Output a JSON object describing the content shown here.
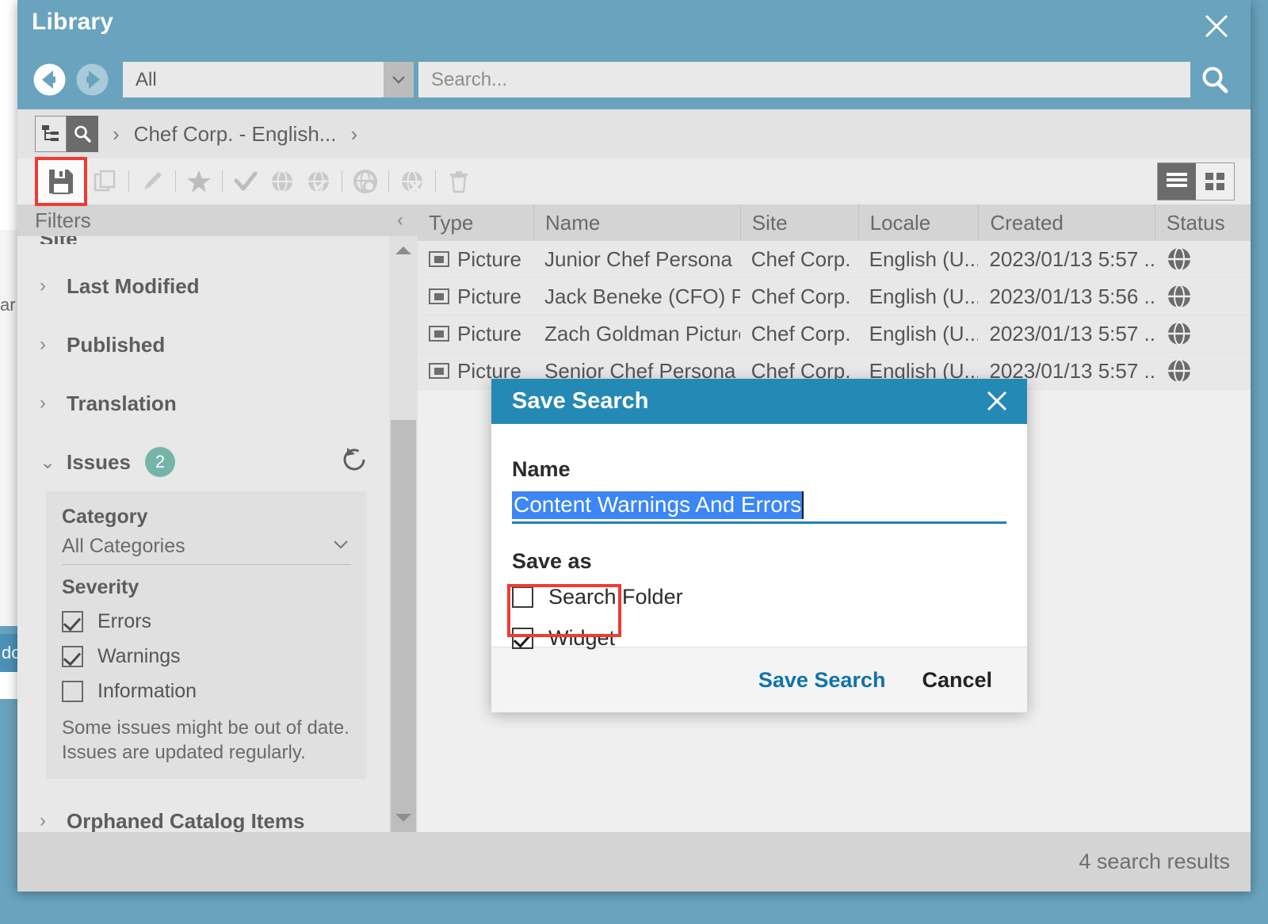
{
  "window": {
    "title": "Library",
    "close_label": "✕"
  },
  "search": {
    "type_value": "All",
    "placeholder": "Search...",
    "back_icon": "arrow-left-circle-icon",
    "forward_icon": "arrow-right-circle-icon",
    "search_icon": "magnifier-icon"
  },
  "breadcrumb": {
    "tree_icon": "tree-view-icon",
    "search_icon": "search-view-icon",
    "separator": "›",
    "path": "Chef Corp. - English...",
    "trailing_separator": "›"
  },
  "toolbar": {
    "items": [
      {
        "name": "save-search",
        "icon": "floppy-disk-icon",
        "disabled": false,
        "highlighted": true
      },
      {
        "name": "copy",
        "icon": "copy-icon",
        "disabled": true
      },
      {
        "name": "edit",
        "icon": "pencil-icon",
        "disabled": true
      },
      {
        "name": "favorite",
        "icon": "star-icon",
        "disabled": true
      },
      {
        "name": "approve",
        "icon": "check-icon",
        "disabled": true
      },
      {
        "name": "publish",
        "icon": "globe-icon",
        "disabled": true
      },
      {
        "name": "publish-approved",
        "icon": "globe-check-icon",
        "disabled": true
      },
      {
        "name": "schedule-publish",
        "icon": "globe-clock-icon",
        "disabled": true
      },
      {
        "name": "unpublish",
        "icon": "globe-x-icon",
        "disabled": true
      },
      {
        "name": "delete",
        "icon": "trash-icon",
        "disabled": true
      }
    ],
    "view_list_icon": "list-view-icon",
    "view_grid_icon": "grid-view-icon"
  },
  "filters": {
    "header": "Filters",
    "collapse_icon": "chevron-left-icon",
    "clipped_top_item": "Site",
    "groups": [
      {
        "label": "Last Modified",
        "expanded": false
      },
      {
        "label": "Published",
        "expanded": false
      },
      {
        "label": "Translation",
        "expanded": false
      }
    ],
    "issues": {
      "label": "Issues",
      "badge": "2",
      "expanded": true,
      "refresh_icon": "refresh-icon",
      "category_heading": "Category",
      "category_value": "All Categories",
      "category_arrow": "chevron-down-icon",
      "severity_heading": "Severity",
      "severity_options": [
        {
          "label": "Errors",
          "checked": true
        },
        {
          "label": "Warnings",
          "checked": true
        },
        {
          "label": "Information",
          "checked": false
        }
      ],
      "note": "Some issues might be out of date. Issues are updated regularly."
    },
    "trailing_group": {
      "label": "Orphaned Catalog Items",
      "expanded": false
    }
  },
  "results": {
    "columns": [
      "Type",
      "Name",
      "Site",
      "Locale",
      "Created",
      "Status"
    ],
    "rows": [
      {
        "type": "Picture",
        "name": "Junior Chef Persona",
        "site": "Chef Corp.",
        "locale": "English (U...",
        "created": "2023/01/13 5:57 ...",
        "status_icon": "globe-icon"
      },
      {
        "type": "Picture",
        "name": "Jack Beneke (CFO) P...",
        "site": "Chef Corp.",
        "locale": "English (U...",
        "created": "2023/01/13 5:56 ...",
        "status_icon": "globe-icon"
      },
      {
        "type": "Picture",
        "name": "Zach Goldman Picture",
        "site": "Chef Corp.",
        "locale": "English (U...",
        "created": "2023/01/13 5:57 ...",
        "status_icon": "globe-icon"
      },
      {
        "type": "Picture",
        "name": "Senior Chef Persona",
        "site": "Chef Corp.",
        "locale": "English (U...",
        "created": "2023/01/13 5:57 ...",
        "status_icon": "globe-icon"
      }
    ],
    "count_label": "4 search results"
  },
  "dialog": {
    "title": "Save Search",
    "close_label": "✕",
    "name_label": "Name",
    "name_value": "Content Warnings And Errors",
    "saveas_label": "Save as",
    "options": [
      {
        "label": "Search Folder",
        "checked": false
      },
      {
        "label": "Widget",
        "checked": true
      }
    ],
    "save_button": "Save Search",
    "cancel_button": "Cancel"
  },
  "background": {
    "left_text_1": "ar",
    "left_text_2": "do"
  },
  "colors": {
    "window_header": "#69a3bd",
    "dialog_header": "#2589b5",
    "accent_link": "#1273a8",
    "selection": "#3c86f5",
    "highlight_box": "#ef3b33",
    "badge": "#74b4a9"
  }
}
